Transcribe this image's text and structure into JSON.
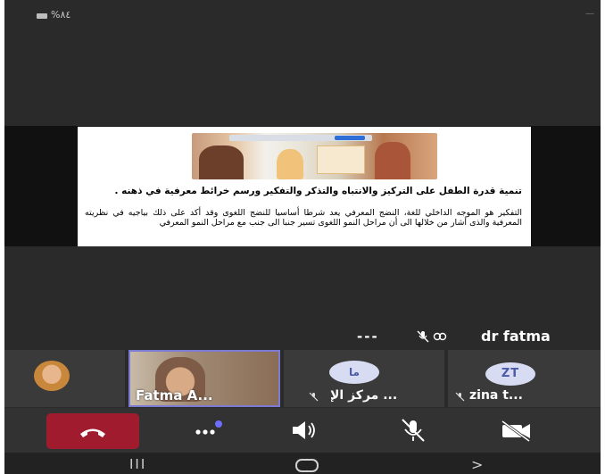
{
  "status_bar": {
    "battery_icon": "battery-icon",
    "battery_text": "%٨٤"
  },
  "shared_content": {
    "photo_icon": "classroom-photo",
    "title": "تنمية قدرة الطفل على التركيز والانتباه والتذكر والتفكير ورسم خرائط معرفية في ذهنه .",
    "body": "التفكير هو الموجه الداخلي للغة، النضج المعرفي يعد شرطا أساسيا للنضج اللغوى وقد أكد على ذلك بياجيه في نظريته المعرفية والذى أشار من خلالها الى أن مراحل النمو اللغوى تسير جنبا الى جنب مع مراحل النمو المعرفي"
  },
  "active_speaker": {
    "dots": "---",
    "mic_icon": "mic-muted-icon",
    "camera_icon": "camera-off-icon",
    "name": "dr fatma"
  },
  "participants": [
    {
      "kind": "avatar",
      "icon": "avatar-photo"
    },
    {
      "kind": "video",
      "name": "Fatma A..."
    },
    {
      "kind": "initials",
      "initials": "ما",
      "name": "مركز الإ ...",
      "mic_icon": "mic-muted-icon"
    },
    {
      "kind": "initials",
      "initials": "ZT",
      "name": "zina t...",
      "mic_icon": "mic-muted-icon"
    }
  ],
  "controls": {
    "end_call_icon": "phone-hangup-icon",
    "more_icon": "more-options-icon",
    "speaker_icon": "speaker-volume-icon",
    "mic_icon": "mic-muted-icon",
    "camera_icon": "camera-off-icon",
    "accent_color": "#a11b2f",
    "notification_dot_color": "#6d6dff"
  },
  "nav_bar": {
    "recent": "III",
    "back": ">"
  }
}
